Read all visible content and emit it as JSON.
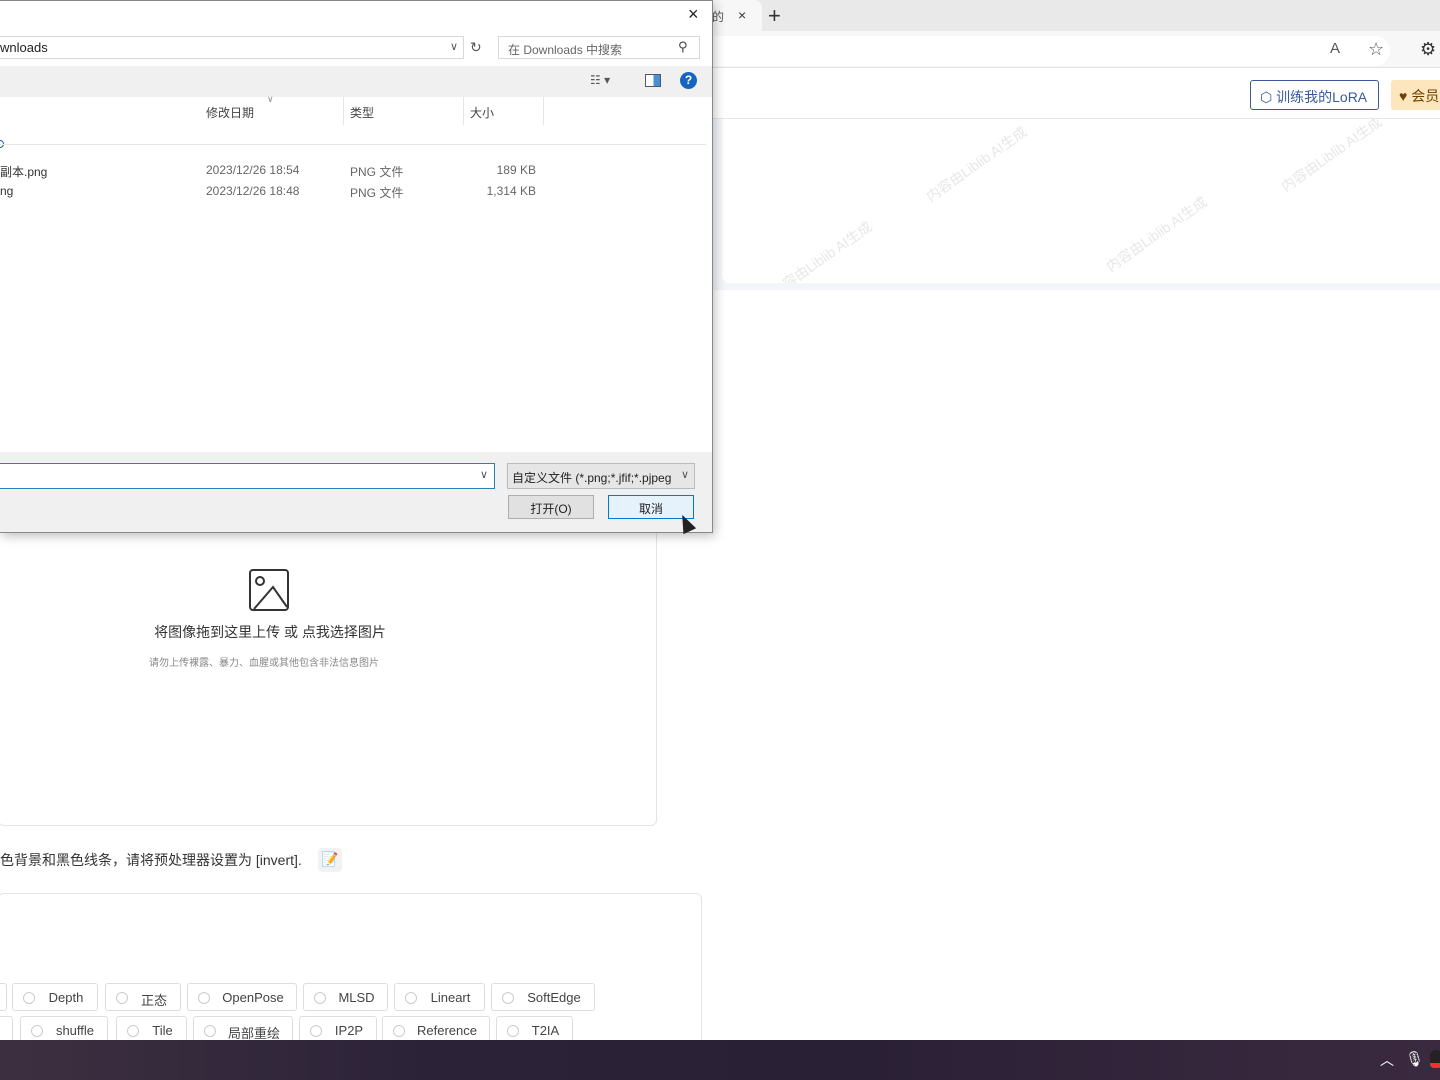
{
  "browser": {
    "tab_title_fragment": "的",
    "tab_close": "×",
    "new_tab": "+",
    "read_aloud": "A",
    "favorite": "☆",
    "extensions": "⚙"
  },
  "page": {
    "header": {
      "train_lora": "训练我的LoRA",
      "vip": "会员"
    },
    "watermark": "内容由Liblib AI生成",
    "upload": {
      "title": "将图像拖到这里上传 或 点我选择图片",
      "subtitle": "请勿上传裸露、暴力、血腥或其他包含非法信息图片"
    },
    "hint": "色背景和黑色线条，请将预处理器设置为 [invert].",
    "control_types_row1": [
      "Depth",
      "正态",
      "OpenPose",
      "MLSD",
      "Lineart",
      "SoftEdge"
    ],
    "control_types_row2": [
      "shuffle",
      "Tile",
      "局部重绘",
      "IP2P",
      "Reference",
      "T2IA"
    ]
  },
  "dialog": {
    "close": "×",
    "address": "wnloads",
    "search_placeholder": "在 Downloads 中搜索",
    "columns": [
      "修改日期",
      "类型",
      "大小"
    ],
    "files": [
      {
        "name": "副本.png",
        "date": "2023/12/26 18:54",
        "type": "PNG 文件",
        "size": "189 KB"
      },
      {
        "name": "ng",
        "date": "2023/12/26 18:48",
        "type": "PNG 文件",
        "size": "1,314 KB"
      }
    ],
    "filename_value": "",
    "file_type": "自定义文件 (*.png;*.jfif;*.pjpeg",
    "open_button": "打开(O)",
    "cancel_button": "取消",
    "help": "?"
  },
  "colors": {
    "accent": "#3a5a9c",
    "dialog_focus": "#0078d7",
    "vip_bg": "#fde6bd"
  }
}
